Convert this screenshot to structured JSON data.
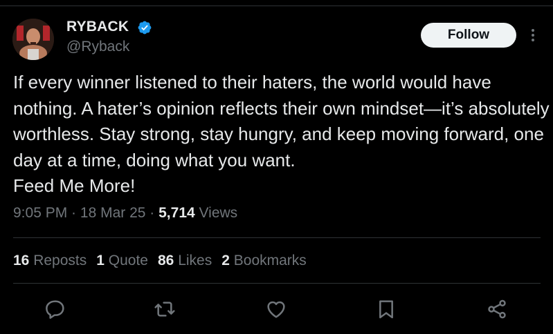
{
  "author": {
    "display_name": "RYBACK",
    "handle": "@Ryback",
    "verified": true
  },
  "follow_button": {
    "label": "Follow"
  },
  "tweet": {
    "text": "If every winner listened to their haters, the world would have nothing. A hater’s opinion reflects their own mindset—it’s absolutely worthless. Stay strong, stay hungry, and keep moving forward, one day at a time, doing what you want.\nFeed Me More!",
    "time": "9:05 PM",
    "separator": " · ",
    "date": "18 Mar 25",
    "views_count": "5,714",
    "views_label": "Views"
  },
  "stats": {
    "reposts": {
      "count": "16",
      "label": "Reposts"
    },
    "quotes": {
      "count": "1",
      "label": "Quote"
    },
    "likes": {
      "count": "86",
      "label": "Likes"
    },
    "bookmarks": {
      "count": "2",
      "label": "Bookmarks"
    }
  },
  "actions": [
    "reply-icon",
    "repost-icon",
    "like-icon",
    "bookmark-icon",
    "share-icon"
  ],
  "colors": {
    "background": "#000000",
    "text": "#e7e9ea",
    "secondary_text": "#71767b",
    "divider": "#2f3336",
    "verified_badge": "#1d9bf0",
    "follow_button_bg": "#eff3f4"
  }
}
